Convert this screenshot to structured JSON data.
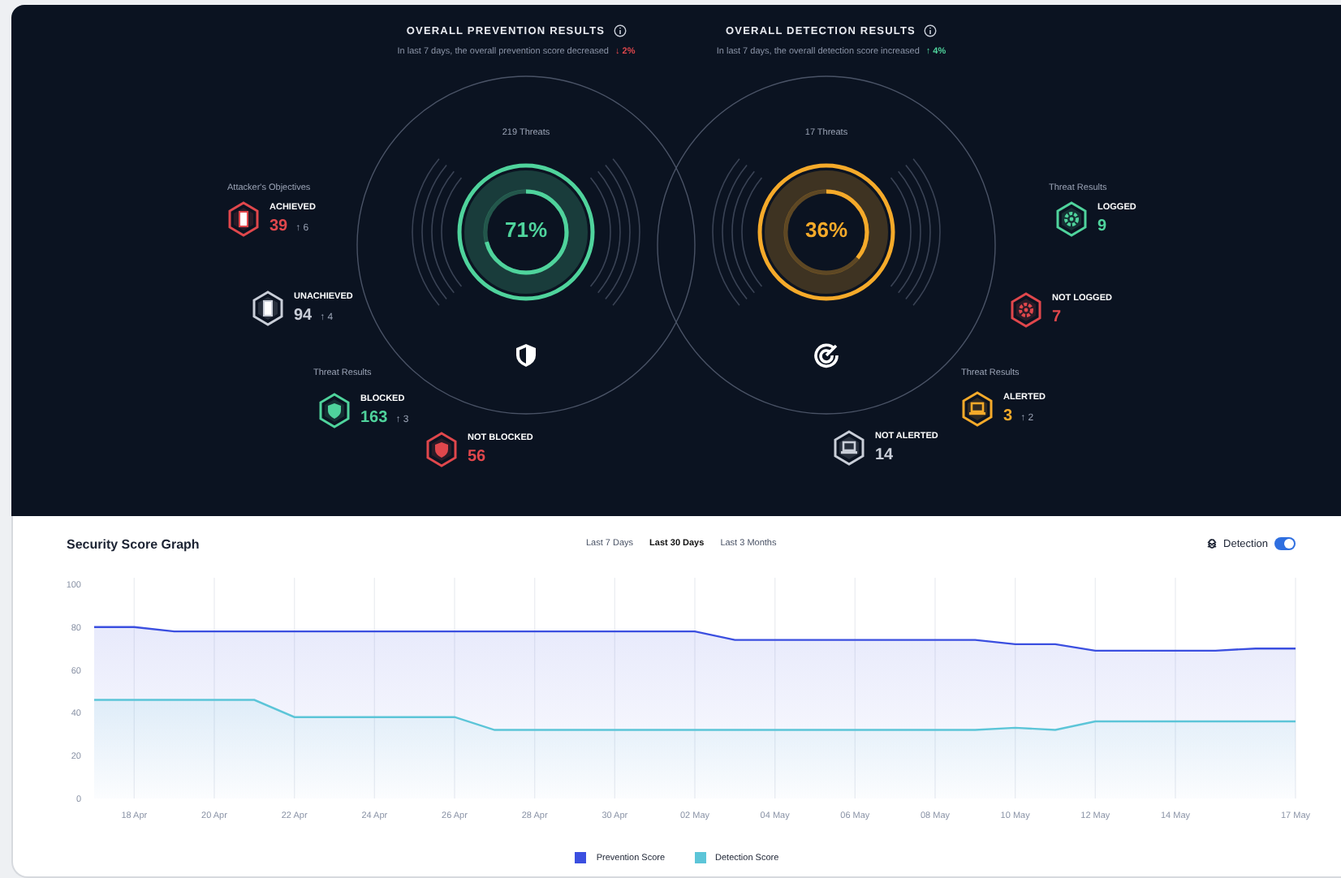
{
  "panels": [
    {
      "kind": "prevention",
      "title": "OVERALL PREVENTION RESULTS",
      "summary": "In last 7 days, the overall prevention score decreased",
      "trend": "↓ 2%",
      "threats": "219 Threats",
      "gauge": {
        "level": 0.71,
        "reading": "71%",
        "color": "#4fd39c"
      },
      "groups": [
        {
          "label": "Attacker's Objectives",
          "items": [
            {
              "kind": "door",
              "label": "ACHIEVED",
              "value": "39",
              "delta": "↑ 6",
              "color": "#e0474c"
            },
            {
              "kind": "door",
              "label": "UNACHIEVED",
              "value": "94",
              "delta": "↑ 4",
              "color": "#c9ced8"
            }
          ]
        },
        {
          "label": "Threat Results",
          "items": [
            {
              "kind": "shield",
              "label": "BLOCKED",
              "value": "163",
              "delta": "↑ 3",
              "color": "#4fd39c"
            },
            {
              "kind": "shield",
              "label": "NOT BLOCKED",
              "value": "56",
              "color": "#e0474c"
            }
          ]
        }
      ]
    },
    {
      "kind": "detection",
      "title": "OVERALL DETECTION RESULTS",
      "summary": "In last 7 days, the overall detection score increased",
      "trend": "↑ 4%",
      "threats": "17 Threats",
      "gauge": {
        "level": 0.36,
        "reading": "36%",
        "color": "#f5aa2a"
      },
      "groups": [
        {
          "label": "Threat Results",
          "items": [
            {
              "kind": "gear",
              "label": "LOGGED",
              "value": "9",
              "color": "#4fd39c"
            },
            {
              "kind": "gear",
              "label": "NOT LOGGED",
              "value": "7",
              "color": "#e0474c"
            }
          ]
        },
        {
          "label": "Threat Results",
          "items": [
            {
              "kind": "laptop",
              "label": "ALERTED",
              "value": "3",
              "delta": "↑ 2",
              "color": "#f5aa2a"
            },
            {
              "kind": "laptop",
              "label": "NOT ALERTED",
              "value": "14",
              "color": "#c9ced8"
            }
          ]
        }
      ]
    }
  ],
  "graph": {
    "title": "Security Score Graph",
    "ranges": [
      {
        "label": "Last 7 Days",
        "selected": false
      },
      {
        "label": "Last 30 Days",
        "selected": true
      },
      {
        "label": "Last 3 Months",
        "selected": false
      }
    ],
    "toggle": {
      "label": "Detection",
      "on": true
    },
    "chart_data": {
      "type": "line",
      "categories": [
        null,
        "18 Apr",
        null,
        "20 Apr",
        null,
        "22 Apr",
        null,
        "24 Apr",
        null,
        "26 Apr",
        null,
        "28 Apr",
        null,
        "30 Apr",
        null,
        "02 May",
        null,
        "04 May",
        null,
        "06 May",
        null,
        "08 May",
        null,
        "10 May",
        null,
        "12 May",
        null,
        "14 May",
        null,
        null,
        "17 May"
      ],
      "series": [
        {
          "name": "Prevention Score",
          "color": "#3b4fe0",
          "values": [
            80,
            80,
            78,
            78,
            78,
            78,
            78,
            78,
            78,
            78,
            78,
            78,
            78,
            78,
            78,
            78,
            74,
            74,
            74,
            74,
            74,
            74,
            74,
            72,
            72,
            69,
            69,
            69,
            69,
            70,
            70
          ]
        },
        {
          "name": "Detection Score",
          "color": "#5cc5d8",
          "values": [
            46,
            46,
            46,
            46,
            46,
            38,
            38,
            38,
            38,
            38,
            32,
            32,
            32,
            32,
            32,
            32,
            32,
            32,
            32,
            32,
            32,
            32,
            32,
            33,
            32,
            36,
            36,
            36,
            36,
            36,
            36
          ]
        }
      ],
      "ylim": [
        0,
        100
      ],
      "yticks": [
        0,
        20,
        40,
        60,
        80,
        100
      ],
      "grid": true
    }
  }
}
